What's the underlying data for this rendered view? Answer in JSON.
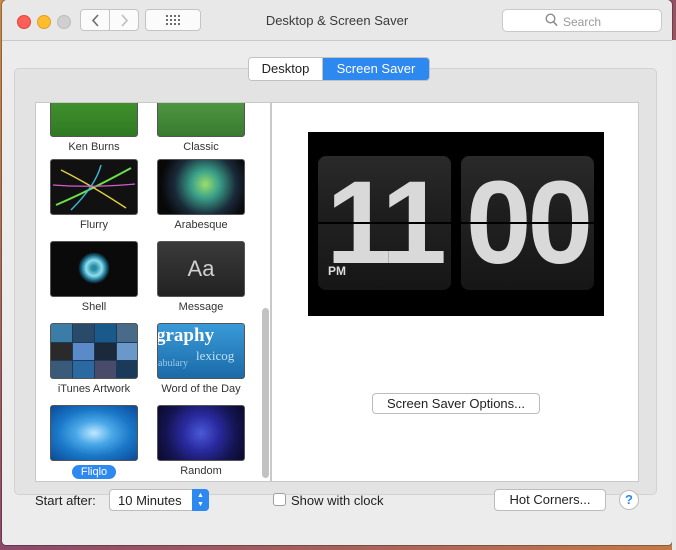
{
  "window": {
    "title": "Desktop & Screen Saver",
    "search_placeholder": "Search"
  },
  "tabs": [
    {
      "label": "Desktop",
      "selected": false
    },
    {
      "label": "Screen Saver",
      "selected": true
    }
  ],
  "savers": [
    {
      "label": "Ken Burns",
      "icon": "ken-burns-thumbnail"
    },
    {
      "label": "Classic",
      "icon": "classic-thumbnail"
    },
    {
      "label": "Flurry",
      "icon": "flurry-thumbnail"
    },
    {
      "label": "Arabesque",
      "icon": "arabesque-thumbnail"
    },
    {
      "label": "Shell",
      "icon": "shell-thumbnail"
    },
    {
      "label": "Message",
      "icon": "message-thumbnail",
      "thumb_text": "Aa"
    },
    {
      "label": "iTunes Artwork",
      "icon": "itunes-artwork-thumbnail"
    },
    {
      "label": "Word of the Day",
      "icon": "word-of-the-day-thumbnail",
      "thumb_text": "graphy",
      "thumb_text2": "lexicog",
      "thumb_text3": "abulary"
    },
    {
      "label": "Fliqlo",
      "icon": "fliqlo-thumbnail",
      "selected": true
    },
    {
      "label": "Random",
      "icon": "random-thumbnail"
    }
  ],
  "preview": {
    "hours": "11",
    "minutes": "00",
    "ampm": "PM",
    "options_button": "Screen Saver Options..."
  },
  "controls": {
    "start_after_label": "Start after:",
    "start_after_value": "10 Minutes",
    "show_with_clock_label": "Show with clock",
    "show_with_clock_checked": false,
    "hot_corners_button": "Hot Corners...",
    "help_label": "?"
  },
  "colors": {
    "accent": "#2d88f0",
    "close": "#fd5f57",
    "minimize": "#febc2e"
  }
}
